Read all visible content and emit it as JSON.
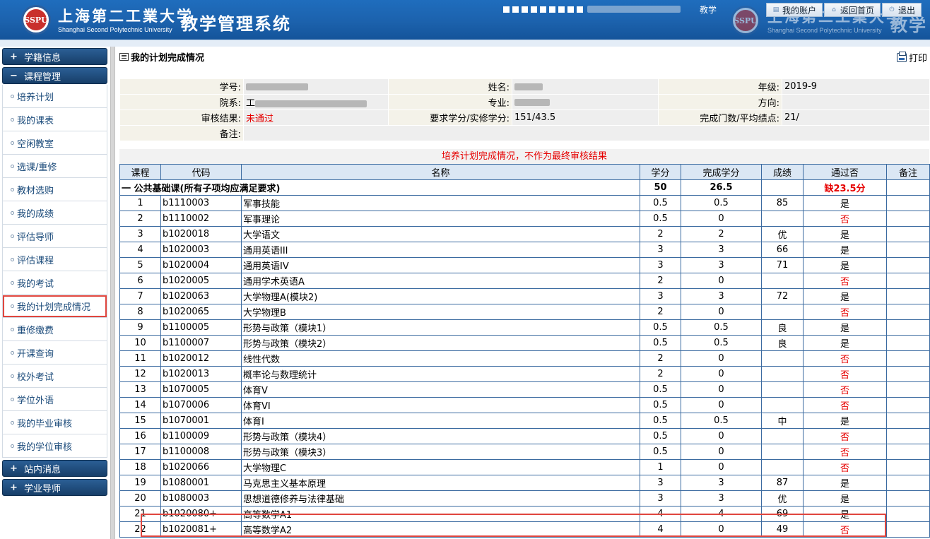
{
  "header": {
    "univ_cn": "上海第二工業大学",
    "univ_en": "Shanghai Second Polytechnic University",
    "logo_text": "SSPU",
    "system_title": "教学管理系统",
    "text_fragment": "教学",
    "nav": [
      {
        "label": "我的账户",
        "icon": "account-icon"
      },
      {
        "label": "返回首页",
        "icon": "home-icon"
      },
      {
        "label": "退出",
        "icon": "power-icon"
      }
    ]
  },
  "sidebar": {
    "groups": [
      {
        "label": "学籍信息",
        "state": "+"
      },
      {
        "label": "课程管理",
        "state": "−"
      },
      {
        "label": "站内消息",
        "state": "+"
      },
      {
        "label": "学业导师",
        "state": "+"
      }
    ],
    "items": [
      "培养计划",
      "我的课表",
      "空闲教室",
      "选课/重修",
      "教材选购",
      "我的成绩",
      "评估导师",
      "评估课程",
      "我的考试",
      "我的计划完成情况",
      "重修缴费",
      "开课查询",
      "校外考试",
      "学位外语",
      "我的毕业审核",
      "我的学位审核"
    ],
    "active_index": 9
  },
  "main": {
    "title": "我的计划完成情况",
    "print_label": "打印",
    "info": {
      "xuehao_label": "学号:",
      "xuehao_prefix": "",
      "name_label": "姓名:",
      "grade_label": "年级:",
      "grade_value": "2019-9",
      "college_label": "院系:",
      "college_prefix": "工",
      "major_label": "专业:",
      "direction_label": "方向:",
      "direction_value": "",
      "audit_label": "审核结果:",
      "audit_value": "未通过",
      "credits_label": "要求学分/实修学分:",
      "credits_value": "151/43.5",
      "count_label": "完成门数/平均绩点:",
      "count_value": "21/",
      "remark_label": "备注:",
      "remark_value": ""
    },
    "note": "培养计划完成情况，不作为最终审核结果",
    "columns": [
      "课程",
      "代码",
      "名称",
      "学分",
      "完成学分",
      "成绩",
      "通过否",
      "备注"
    ],
    "section": {
      "name": "一 公共基础课(所有子项均应满足要求)",
      "credits": "50",
      "done": "26.5",
      "status": "缺23.5分"
    },
    "rows": [
      {
        "no": "1",
        "code": "b1110003",
        "name": "军事技能",
        "credit": "0.5",
        "done": "0.5",
        "score": "85",
        "pass": "是"
      },
      {
        "no": "2",
        "code": "b1110002",
        "name": "军事理论",
        "credit": "0.5",
        "done": "0",
        "score": "",
        "pass": "否"
      },
      {
        "no": "3",
        "code": "b1020018",
        "name": "大学语文",
        "credit": "2",
        "done": "2",
        "score": "优",
        "pass": "是"
      },
      {
        "no": "4",
        "code": "b1020003",
        "name": "通用英语III",
        "credit": "3",
        "done": "3",
        "score": "66",
        "pass": "是"
      },
      {
        "no": "5",
        "code": "b1020004",
        "name": "通用英语IV",
        "credit": "3",
        "done": "3",
        "score": "71",
        "pass": "是"
      },
      {
        "no": "6",
        "code": "b1020005",
        "name": "通用学术英语A",
        "credit": "2",
        "done": "0",
        "score": "",
        "pass": "否"
      },
      {
        "no": "7",
        "code": "b1020063",
        "name": "大学物理A(模块2)",
        "credit": "3",
        "done": "3",
        "score": "72",
        "pass": "是"
      },
      {
        "no": "8",
        "code": "b1020065",
        "name": "大学物理B",
        "credit": "2",
        "done": "0",
        "score": "",
        "pass": "否"
      },
      {
        "no": "9",
        "code": "b1100005",
        "name": "形势与政策（模块1）",
        "credit": "0.5",
        "done": "0.5",
        "score": "良",
        "pass": "是"
      },
      {
        "no": "10",
        "code": "b1100007",
        "name": "形势与政策（模块2）",
        "credit": "0.5",
        "done": "0.5",
        "score": "良",
        "pass": "是"
      },
      {
        "no": "11",
        "code": "b1020012",
        "name": "线性代数",
        "credit": "2",
        "done": "0",
        "score": "",
        "pass": "否"
      },
      {
        "no": "12",
        "code": "b1020013",
        "name": "概率论与数理统计",
        "credit": "2",
        "done": "0",
        "score": "",
        "pass": "否"
      },
      {
        "no": "13",
        "code": "b1070005",
        "name": "体育V",
        "credit": "0.5",
        "done": "0",
        "score": "",
        "pass": "否"
      },
      {
        "no": "14",
        "code": "b1070006",
        "name": "体育VI",
        "credit": "0.5",
        "done": "0",
        "score": "",
        "pass": "否"
      },
      {
        "no": "15",
        "code": "b1070001",
        "name": "体育I",
        "credit": "0.5",
        "done": "0.5",
        "score": "中",
        "pass": "是"
      },
      {
        "no": "16",
        "code": "b1100009",
        "name": "形势与政策（模块4）",
        "credit": "0.5",
        "done": "0",
        "score": "",
        "pass": "否"
      },
      {
        "no": "17",
        "code": "b1100008",
        "name": "形势与政策（模块3）",
        "credit": "0.5",
        "done": "0",
        "score": "",
        "pass": "否"
      },
      {
        "no": "18",
        "code": "b1020066",
        "name": "大学物理C",
        "credit": "1",
        "done": "0",
        "score": "",
        "pass": "否"
      },
      {
        "no": "19",
        "code": "b1080001",
        "name": "马克思主义基本原理",
        "credit": "3",
        "done": "3",
        "score": "87",
        "pass": "是"
      },
      {
        "no": "20",
        "code": "b1080003",
        "name": "思想道德修养与法律基础",
        "credit": "3",
        "done": "3",
        "score": "优",
        "pass": "是"
      },
      {
        "no": "21",
        "code": "b1020080+",
        "name": "高等数学A1",
        "credit": "4",
        "done": "4",
        "score": "69",
        "pass": "是"
      },
      {
        "no": "22",
        "code": "b1020081+",
        "name": "高等数学A2",
        "credit": "4",
        "done": "0",
        "score": "49",
        "pass": "否"
      }
    ]
  }
}
